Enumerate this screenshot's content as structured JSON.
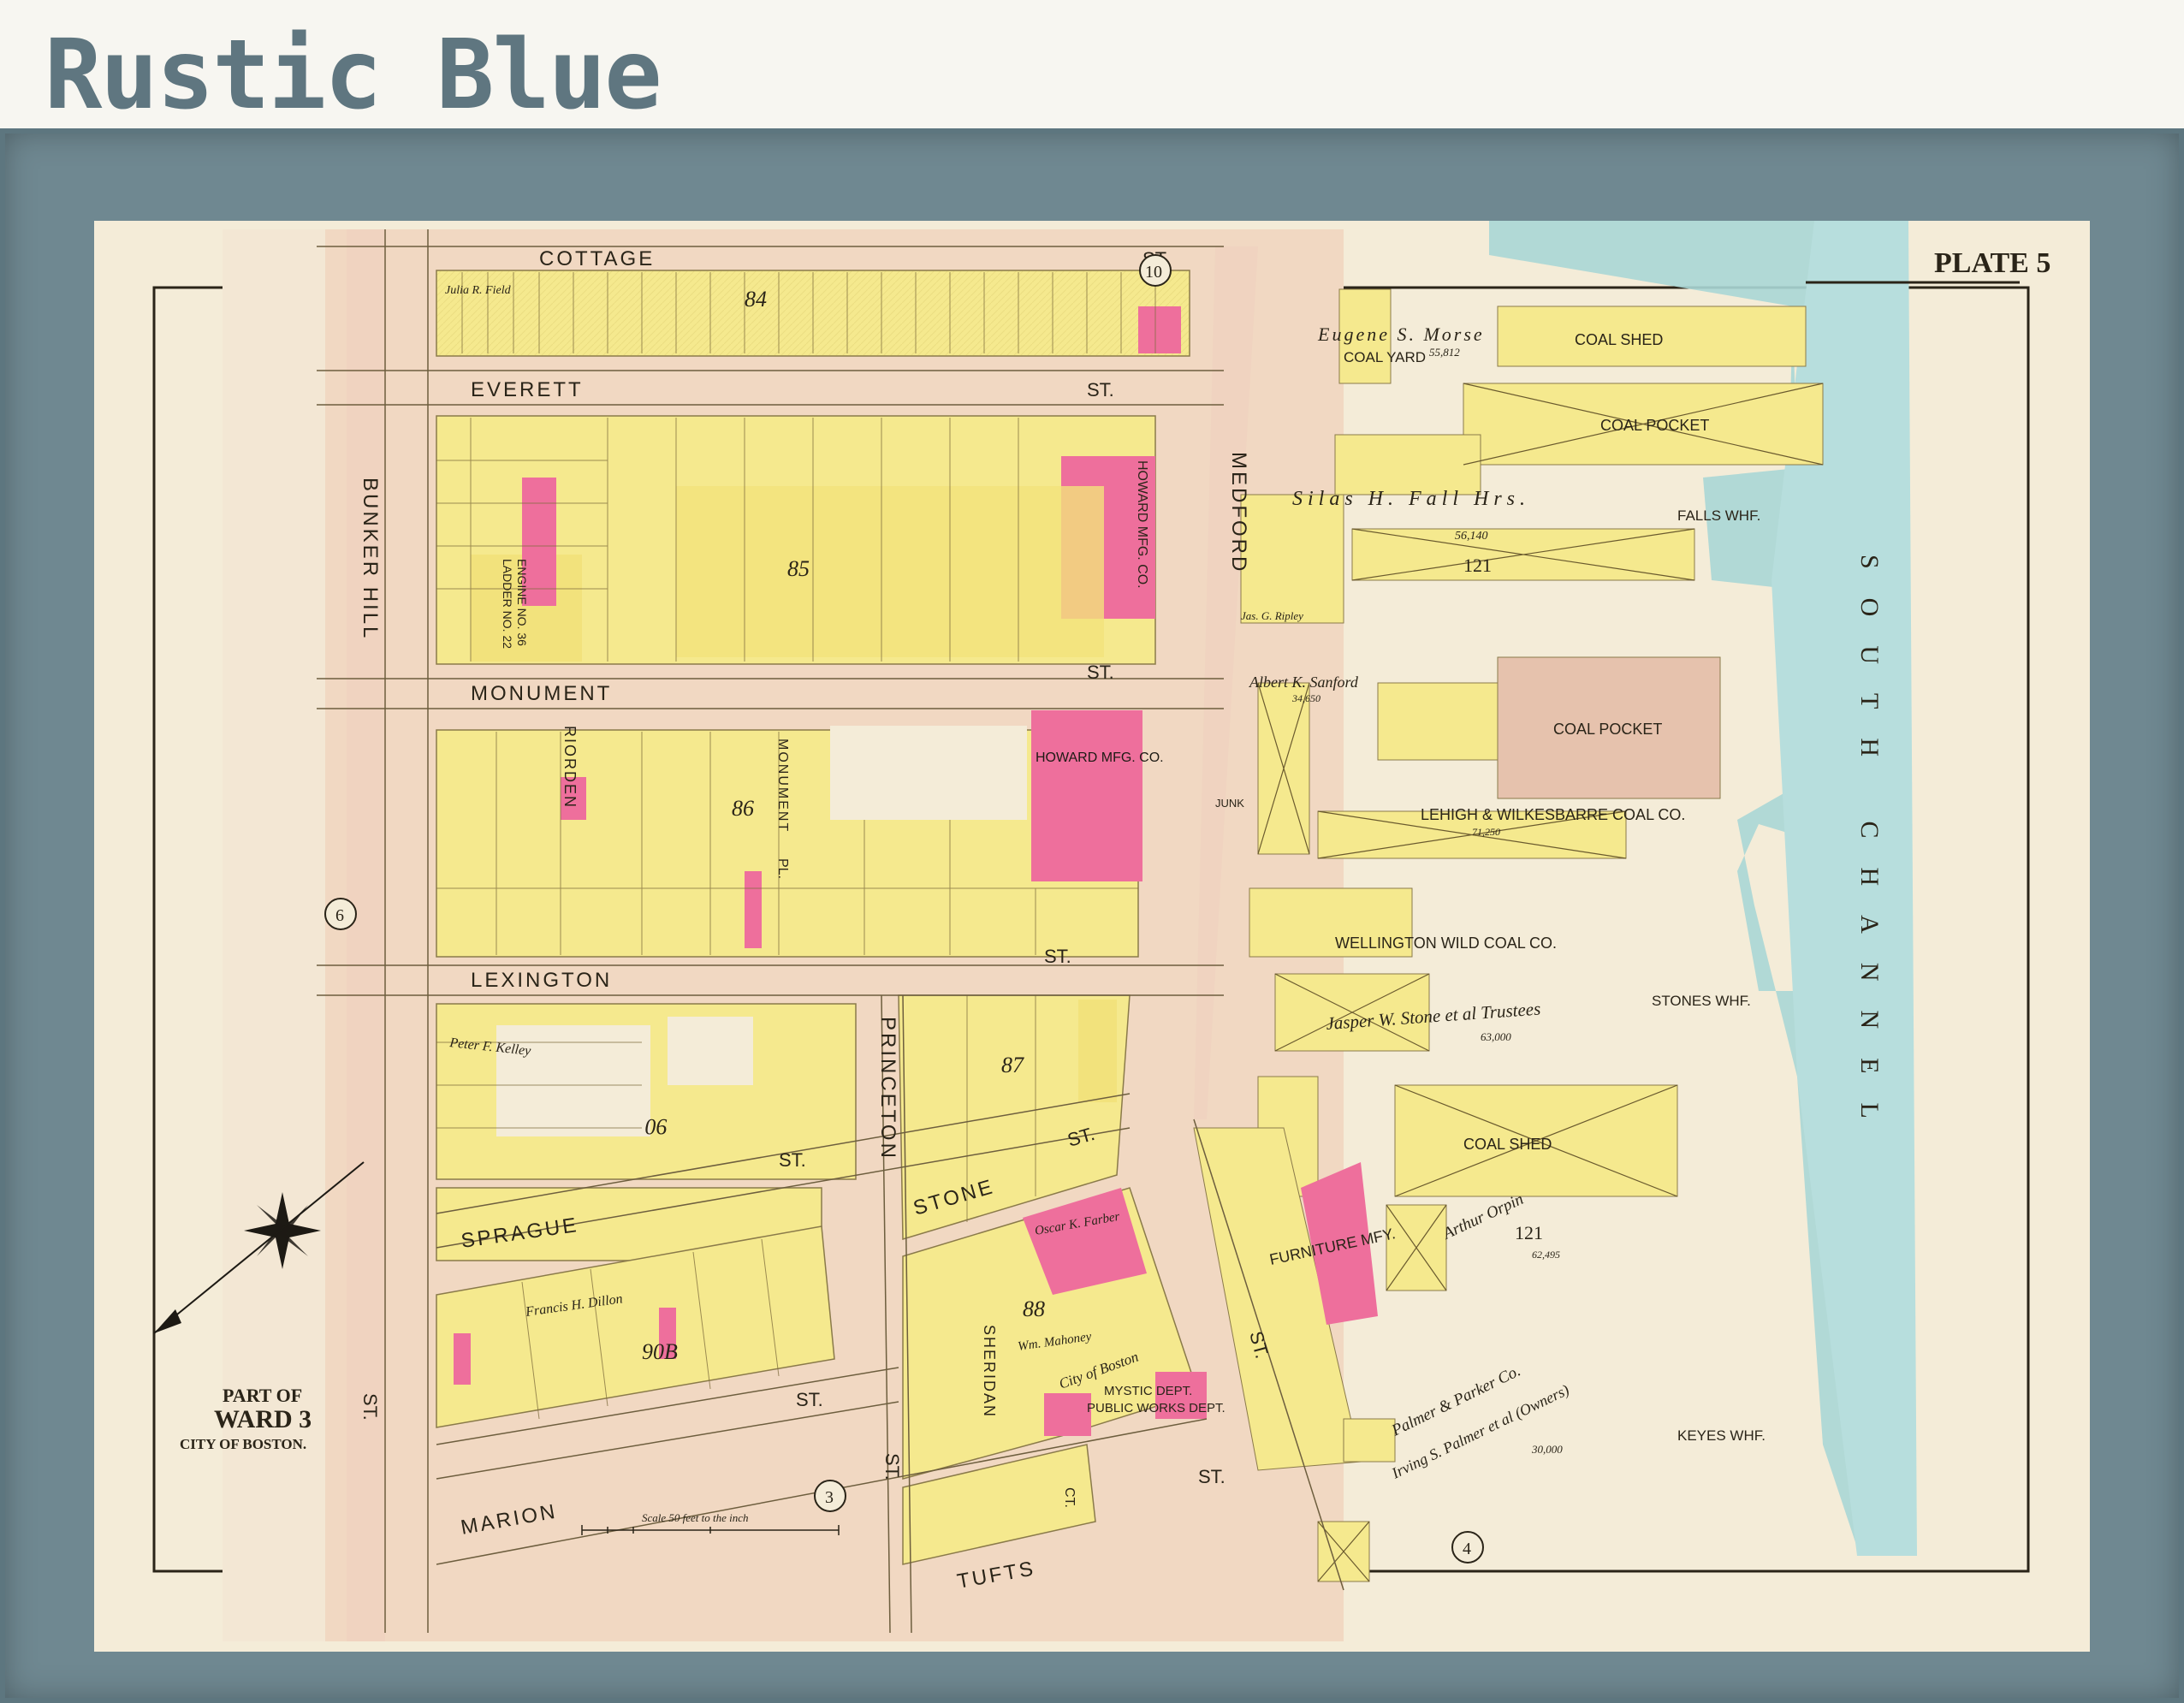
{
  "title": "Rustic Blue",
  "plate": "PLATE 5",
  "ward": {
    "part_of": "PART OF",
    "ward": "WARD 3",
    "city": "CITY OF BOSTON."
  },
  "scale_text": "Scale 50 feet to the inch",
  "water_label": "SOUTH CHANNEL",
  "streets": {
    "cottage": "COTTAGE",
    "everett": "EVERETT",
    "monument": "MONUMENT",
    "lexington": "LEXINGTON",
    "sprague": "SPRAGUE",
    "marion": "MARION",
    "tufts": "TUFTS",
    "stone": "STONE",
    "medford": "MEDFORD",
    "bunker_hill": "BUNKER HILL",
    "princeton": "PRINCETON",
    "sheridan": "SHERIDAN",
    "riorden": "RIORDEN",
    "st": "ST.",
    "pl": "PL.",
    "ct": "CT."
  },
  "blocks": [
    "84",
    "85",
    "86",
    "87",
    "88",
    "90",
    "90B"
  ],
  "circled_numbers": [
    "10",
    "6",
    "3",
    "4"
  ],
  "wharf_labels": {
    "coal_shed": "COAL SHED",
    "coal_yard": "COAL YARD",
    "coal_pocket": "COAL POCKET",
    "falls_whf": "FALLS WHF.",
    "lehigh": "LEHIGH & WILKESBARRE COAL CO.",
    "wellington": "WELLINGTON WILD COAL CO.",
    "stones_whf": "STONES WHF.",
    "keyes_whf": "KEYES WHF.",
    "furniture": "FURNITURE MFY.",
    "howard": "HOWARD MFG. CO.",
    "mystic": "MYSTIC DEPT.",
    "public_works": "PUBLIC WORKS DEPT.",
    "city_boston": "City of Boston",
    "junk": "JUNK",
    "engine": "ENGINE NO. 36",
    "ladder": "LADDER NO. 22"
  },
  "owners": {
    "morse": "Eugene S. Morse",
    "fall": "Silas H. Fall Hrs.",
    "sanford": "Albert K. Sanford",
    "ripley": "Jas. G. Ripley",
    "stone": "Jasper W. Stone et al Trustees",
    "orpin": "Arthur Orpin",
    "palmer": "Palmer & Parker Co.",
    "irving": "Irving S. Palmer et al (Owners)",
    "farber": "Oscar K. Farber",
    "mahoney": "Wm. Mahoney",
    "dillon": "Francis H. Dillon",
    "kelley": "Peter F. Kelley",
    "field": "Julia R. Field"
  },
  "areas": {
    "morse": "55,812",
    "fall": "56,140",
    "sanford": "34,650",
    "lehigh": "71,250",
    "stone": "63,000",
    "irving": "30,000",
    "orpin": "62,495",
    "block121": "121"
  },
  "colors": {
    "paper": "#f4ecd8",
    "brick": "#f2e27c",
    "wood": "#f5e98e",
    "pink": "#ee6f9c",
    "water": "#aad7d6",
    "street": "#f1d8c2",
    "frame": "#6f8891",
    "ink": "#2a2418"
  }
}
